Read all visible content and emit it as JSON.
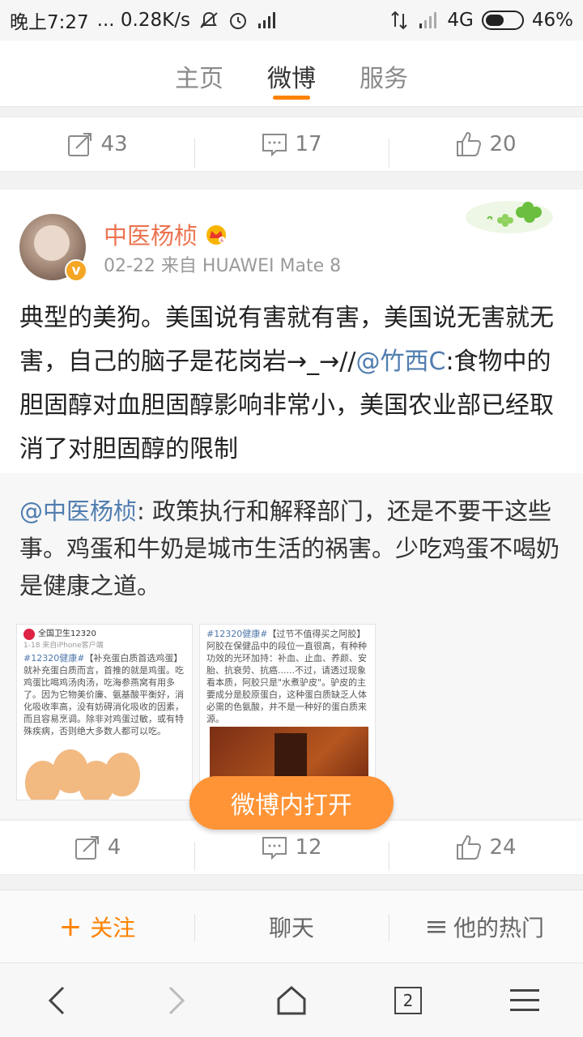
{
  "status_bar": {
    "time": "晚上7:27",
    "speed": "... 0.28K/s",
    "network": "4G",
    "battery": "46%",
    "battery_level": 0.46
  },
  "nav_tabs": [
    {
      "label": "主页",
      "active": false
    },
    {
      "label": "微博",
      "active": true
    },
    {
      "label": "服务",
      "active": false
    }
  ],
  "prev_post_actions": {
    "repost": "43",
    "comment": "17",
    "like": "20"
  },
  "post": {
    "username": "中医杨桢",
    "meta": "02-22 来自 HUAWEI Mate 8",
    "text_before": "典型的美狗。美国说有害就有害，美国说无害就无害，自己的脑子是花岗岩→_→//",
    "mention": "@竹西C",
    "text_after": ":食物中的胆固醇对血胆固醇影响非常小，美国农业部已经取消了对胆固醇的限制",
    "repost": {
      "mention": "@中医杨桢",
      "text": ": 政策执行和解释部门，还是不要干这些事。鸡蛋和牛奶是城市生活的祸害。少吃鸡蛋不喝奶是健康之道。",
      "image1": {
        "account": "全国卫生12320",
        "date": "1-18  来自iPhone客户端",
        "tag": "#12320健康#",
        "text": "【补充蛋白质首选鸡蛋】就补充蛋白质而言，首推的就是鸡蛋。吃鸡蛋比喝鸡汤肉汤，吃海参燕窝有用多了。因为它物美价廉、氨基酸平衡好，消化吸收率高，没有妨碍消化吸收的因素，而且容易烹调。除非对鸡蛋过敏，或有特殊疾病，否则绝大多数人都可以吃。"
      },
      "image2": {
        "tag": "#12320健康#",
        "text": "【过节不值得买之阿胶】阿胶在保健品中的段位一直很高，有种种功效的光环加持：补血、止血、养颜、安胎、抗衰劳、抗癌......不过，请透过现象看本质，阿胶只是\"水煮驴皮\"。驴皮的主要成分是胶原蛋白，这种蛋白质缺乏人体必需的色氨酸，并不是一种好的蛋白质来源。"
      }
    },
    "actions": {
      "repost": "4",
      "comment": "12",
      "like": "24"
    }
  },
  "open_in_weibo": "微博内打开",
  "bottom_bar": {
    "follow": "关注",
    "chat": "聊天",
    "hot": "他的热门"
  },
  "browser_nav": {
    "tab_count": "2"
  },
  "colors": {
    "accent": "#ff8200",
    "username": "#eb7350",
    "link": "#507daf",
    "button": "#ff9437"
  }
}
